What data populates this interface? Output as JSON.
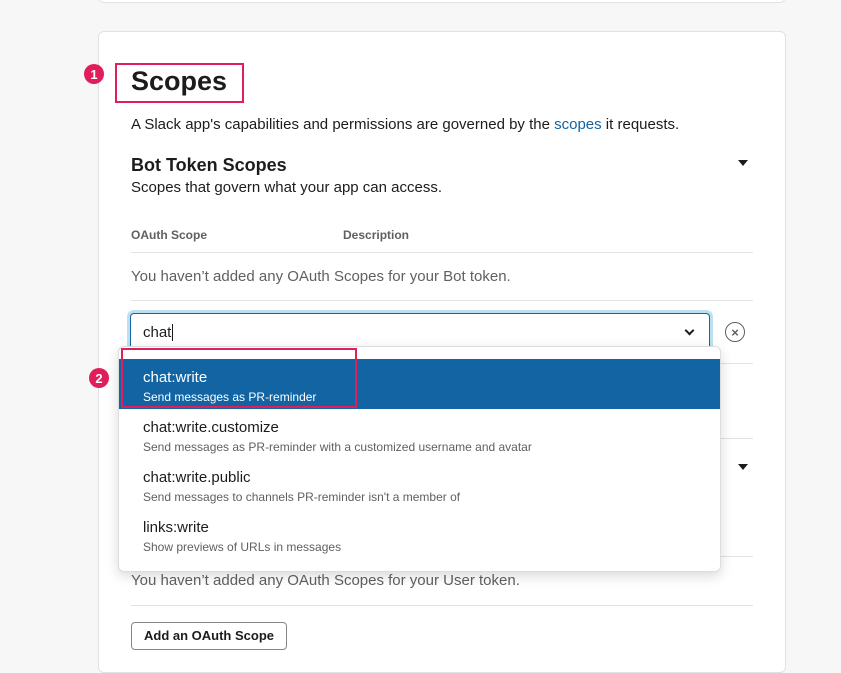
{
  "annotations": {
    "badge_1": "1",
    "badge_2": "2"
  },
  "scopes": {
    "title": "Scopes",
    "description_prefix": "A Slack app's capabilities and permissions are governed by the ",
    "description_link": "scopes",
    "description_suffix": " it requests."
  },
  "bot_token": {
    "title": "Bot Token Scopes",
    "subtitle": "Scopes that govern what your app can access.",
    "col_scope": "OAuth Scope",
    "col_description": "Description",
    "empty_text": "You haven’t added any OAuth Scopes for your Bot token.",
    "search_value": "chat"
  },
  "dropdown": {
    "options": [
      {
        "label": "chat:write",
        "description": "Send messages as PR-reminder",
        "selected": true
      },
      {
        "label": "chat:write.customize",
        "description": "Send messages as PR-reminder with a customized username and avatar"
      },
      {
        "label": "chat:write.public",
        "description": "Send messages to channels PR-reminder isn't a member of"
      },
      {
        "label": "links:write",
        "description": "Show previews of URLs in messages"
      }
    ]
  },
  "user_token": {
    "empty_text": "You haven’t added any OAuth Scopes for your User token.",
    "add_button": "Add an OAuth Scope"
  },
  "icons": {
    "clear": "close-circle-icon",
    "chevron": "chevron-down-icon",
    "caret": "caret-down-icon"
  },
  "colors": {
    "accent": "#1264a3",
    "annotation": "#e01e5a"
  }
}
